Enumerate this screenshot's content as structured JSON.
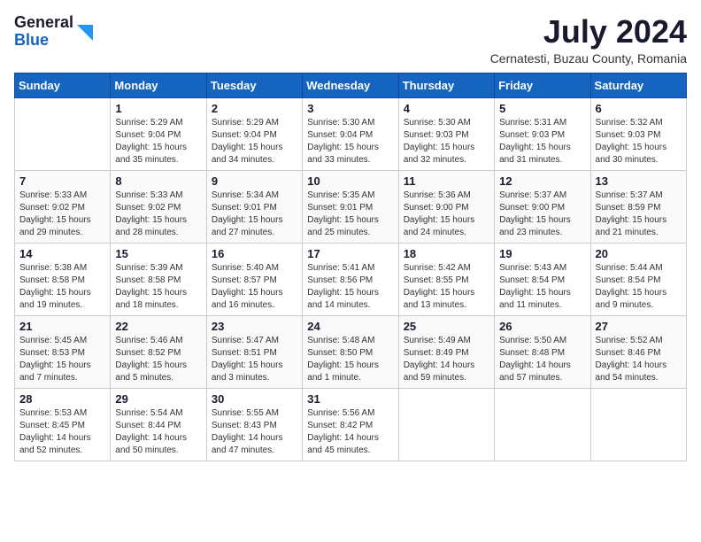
{
  "header": {
    "logo_general": "General",
    "logo_blue": "Blue",
    "month": "July 2024",
    "location": "Cernatesti, Buzau County, Romania"
  },
  "weekdays": [
    "Sunday",
    "Monday",
    "Tuesday",
    "Wednesday",
    "Thursday",
    "Friday",
    "Saturday"
  ],
  "weeks": [
    [
      {
        "day": "",
        "sunrise": "",
        "sunset": "",
        "daylight": ""
      },
      {
        "day": "1",
        "sunrise": "Sunrise: 5:29 AM",
        "sunset": "Sunset: 9:04 PM",
        "daylight": "Daylight: 15 hours and 35 minutes."
      },
      {
        "day": "2",
        "sunrise": "Sunrise: 5:29 AM",
        "sunset": "Sunset: 9:04 PM",
        "daylight": "Daylight: 15 hours and 34 minutes."
      },
      {
        "day": "3",
        "sunrise": "Sunrise: 5:30 AM",
        "sunset": "Sunset: 9:04 PM",
        "daylight": "Daylight: 15 hours and 33 minutes."
      },
      {
        "day": "4",
        "sunrise": "Sunrise: 5:30 AM",
        "sunset": "Sunset: 9:03 PM",
        "daylight": "Daylight: 15 hours and 32 minutes."
      },
      {
        "day": "5",
        "sunrise": "Sunrise: 5:31 AM",
        "sunset": "Sunset: 9:03 PM",
        "daylight": "Daylight: 15 hours and 31 minutes."
      },
      {
        "day": "6",
        "sunrise": "Sunrise: 5:32 AM",
        "sunset": "Sunset: 9:03 PM",
        "daylight": "Daylight: 15 hours and 30 minutes."
      }
    ],
    [
      {
        "day": "7",
        "sunrise": "Sunrise: 5:33 AM",
        "sunset": "Sunset: 9:02 PM",
        "daylight": "Daylight: 15 hours and 29 minutes."
      },
      {
        "day": "8",
        "sunrise": "Sunrise: 5:33 AM",
        "sunset": "Sunset: 9:02 PM",
        "daylight": "Daylight: 15 hours and 28 minutes."
      },
      {
        "day": "9",
        "sunrise": "Sunrise: 5:34 AM",
        "sunset": "Sunset: 9:01 PM",
        "daylight": "Daylight: 15 hours and 27 minutes."
      },
      {
        "day": "10",
        "sunrise": "Sunrise: 5:35 AM",
        "sunset": "Sunset: 9:01 PM",
        "daylight": "Daylight: 15 hours and 25 minutes."
      },
      {
        "day": "11",
        "sunrise": "Sunrise: 5:36 AM",
        "sunset": "Sunset: 9:00 PM",
        "daylight": "Daylight: 15 hours and 24 minutes."
      },
      {
        "day": "12",
        "sunrise": "Sunrise: 5:37 AM",
        "sunset": "Sunset: 9:00 PM",
        "daylight": "Daylight: 15 hours and 23 minutes."
      },
      {
        "day": "13",
        "sunrise": "Sunrise: 5:37 AM",
        "sunset": "Sunset: 8:59 PM",
        "daylight": "Daylight: 15 hours and 21 minutes."
      }
    ],
    [
      {
        "day": "14",
        "sunrise": "Sunrise: 5:38 AM",
        "sunset": "Sunset: 8:58 PM",
        "daylight": "Daylight: 15 hours and 19 minutes."
      },
      {
        "day": "15",
        "sunrise": "Sunrise: 5:39 AM",
        "sunset": "Sunset: 8:58 PM",
        "daylight": "Daylight: 15 hours and 18 minutes."
      },
      {
        "day": "16",
        "sunrise": "Sunrise: 5:40 AM",
        "sunset": "Sunset: 8:57 PM",
        "daylight": "Daylight: 15 hours and 16 minutes."
      },
      {
        "day": "17",
        "sunrise": "Sunrise: 5:41 AM",
        "sunset": "Sunset: 8:56 PM",
        "daylight": "Daylight: 15 hours and 14 minutes."
      },
      {
        "day": "18",
        "sunrise": "Sunrise: 5:42 AM",
        "sunset": "Sunset: 8:55 PM",
        "daylight": "Daylight: 15 hours and 13 minutes."
      },
      {
        "day": "19",
        "sunrise": "Sunrise: 5:43 AM",
        "sunset": "Sunset: 8:54 PM",
        "daylight": "Daylight: 15 hours and 11 minutes."
      },
      {
        "day": "20",
        "sunrise": "Sunrise: 5:44 AM",
        "sunset": "Sunset: 8:54 PM",
        "daylight": "Daylight: 15 hours and 9 minutes."
      }
    ],
    [
      {
        "day": "21",
        "sunrise": "Sunrise: 5:45 AM",
        "sunset": "Sunset: 8:53 PM",
        "daylight": "Daylight: 15 hours and 7 minutes."
      },
      {
        "day": "22",
        "sunrise": "Sunrise: 5:46 AM",
        "sunset": "Sunset: 8:52 PM",
        "daylight": "Daylight: 15 hours and 5 minutes."
      },
      {
        "day": "23",
        "sunrise": "Sunrise: 5:47 AM",
        "sunset": "Sunset: 8:51 PM",
        "daylight": "Daylight: 15 hours and 3 minutes."
      },
      {
        "day": "24",
        "sunrise": "Sunrise: 5:48 AM",
        "sunset": "Sunset: 8:50 PM",
        "daylight": "Daylight: 15 hours and 1 minute."
      },
      {
        "day": "25",
        "sunrise": "Sunrise: 5:49 AM",
        "sunset": "Sunset: 8:49 PM",
        "daylight": "Daylight: 14 hours and 59 minutes."
      },
      {
        "day": "26",
        "sunrise": "Sunrise: 5:50 AM",
        "sunset": "Sunset: 8:48 PM",
        "daylight": "Daylight: 14 hours and 57 minutes."
      },
      {
        "day": "27",
        "sunrise": "Sunrise: 5:52 AM",
        "sunset": "Sunset: 8:46 PM",
        "daylight": "Daylight: 14 hours and 54 minutes."
      }
    ],
    [
      {
        "day": "28",
        "sunrise": "Sunrise: 5:53 AM",
        "sunset": "Sunset: 8:45 PM",
        "daylight": "Daylight: 14 hours and 52 minutes."
      },
      {
        "day": "29",
        "sunrise": "Sunrise: 5:54 AM",
        "sunset": "Sunset: 8:44 PM",
        "daylight": "Daylight: 14 hours and 50 minutes."
      },
      {
        "day": "30",
        "sunrise": "Sunrise: 5:55 AM",
        "sunset": "Sunset: 8:43 PM",
        "daylight": "Daylight: 14 hours and 47 minutes."
      },
      {
        "day": "31",
        "sunrise": "Sunrise: 5:56 AM",
        "sunset": "Sunset: 8:42 PM",
        "daylight": "Daylight: 14 hours and 45 minutes."
      },
      {
        "day": "",
        "sunrise": "",
        "sunset": "",
        "daylight": ""
      },
      {
        "day": "",
        "sunrise": "",
        "sunset": "",
        "daylight": ""
      },
      {
        "day": "",
        "sunrise": "",
        "sunset": "",
        "daylight": ""
      }
    ]
  ]
}
